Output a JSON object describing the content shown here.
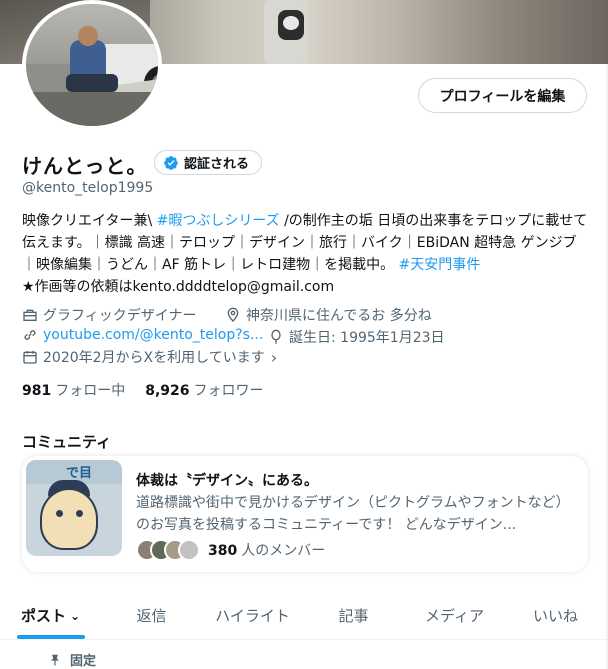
{
  "profile": {
    "edit_button": "プロフィールを編集",
    "name": "けんとっと。",
    "verify_button": "認証される",
    "handle": "@kento_telop1995",
    "bio": {
      "text1": "映像クリエイター兼\\ ",
      "hashtag1": "#暇つぶしシリーズ",
      "text2": " /の制作主の垢 日頃の出来事をテロップに載せて伝えます。｜標識 高速｜テロップ｜デザイン｜旅行｜バイク｜EBiDAN 超特急 ゲンジブ｜映像編集｜うどん｜AF 筋トレ｜レトロ建物｜を掲載中。",
      "hashtag2": "#天安門事件",
      "line2": "★作画等の依頼はkento.ddddtelop@gmail.com"
    },
    "meta": {
      "category": "グラフィックデザイナー",
      "location": "神奈川県に住んでるお 多分ね",
      "link": "youtube.com/@kento_telop?s...",
      "birthday": "誕生日: 1995年1月23日",
      "joined": "2020年2月からXを利用しています"
    },
    "following_count": "981",
    "following_label": "フォロー中",
    "followers_count": "8,926",
    "followers_label": "フォロワー"
  },
  "community": {
    "heading": "コミュニティ",
    "title": "体裁は〝デザイン〟にある。",
    "description": "道路標識や街中で見かけるデザイン（ピクトグラムやフォントなど）のお写真を投稿するコミュニティーです！ どんなデザイン...",
    "member_count": "380",
    "member_label": "人のメンバー",
    "image_text": "で目"
  },
  "tabs": [
    {
      "label": "ポスト"
    },
    {
      "label": "返信"
    },
    {
      "label": "ハイライト"
    },
    {
      "label": "記事"
    },
    {
      "label": "メディア"
    },
    {
      "label": "いいね"
    }
  ],
  "pinned_label": "固定",
  "colors": {
    "accent": "#1d9bf0",
    "text": "#0f1419",
    "secondary": "#536471"
  }
}
